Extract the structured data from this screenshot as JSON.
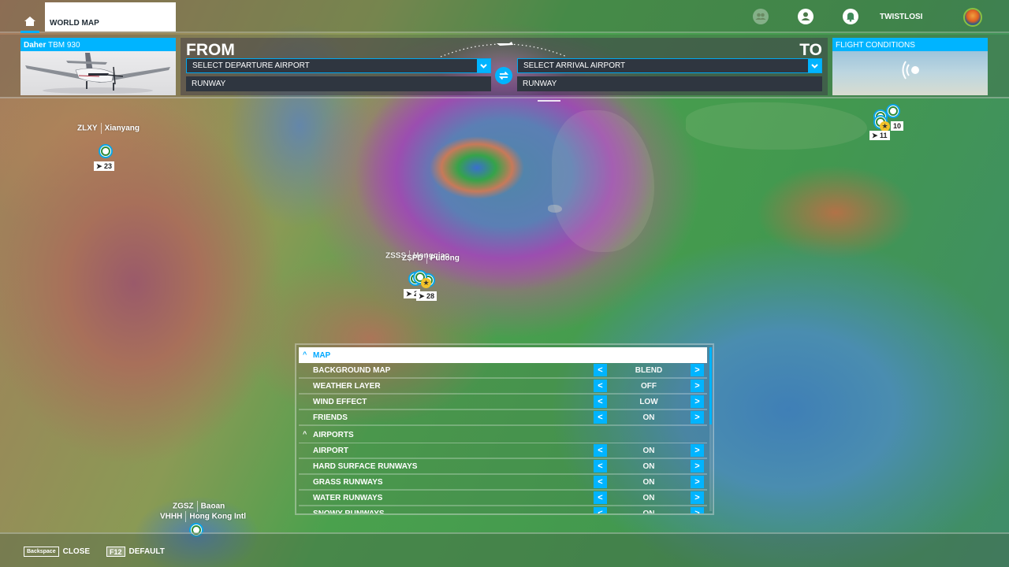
{
  "topbar": {
    "tab_label": "WORLD MAP",
    "username": "TWISTLOSI",
    "icons": [
      "home-icon",
      "friends-icon",
      "profile-icon",
      "notification-bell-icon",
      "avatar"
    ]
  },
  "aircraft": {
    "brand": "Daher",
    "model": "TBM 930"
  },
  "route": {
    "from_label": "FROM",
    "to_label": "TO",
    "departure_placeholder": "SELECT DEPARTURE AIRPORT",
    "arrival_placeholder": "SELECT ARRIVAL AIRPORT",
    "departure_runway": "RUNWAY",
    "arrival_runway": "RUNWAY"
  },
  "conditions": {
    "title": "FLIGHT CONDITIONS",
    "icon": "live-weather-icon"
  },
  "map_markers": [
    {
      "icao": "ZLXY",
      "name": "Xianyang",
      "runways": "23"
    },
    {
      "icao": "ZSSS",
      "name": "Hongqiao",
      "runways": "2"
    },
    {
      "icao": "ZSPD",
      "name": "Pudong",
      "runways": "28"
    },
    {
      "icao": "",
      "name": "",
      "runways": "10",
      "starred": true
    },
    {
      "icao": "",
      "name": "",
      "runways": "11"
    },
    {
      "icao": "ZGSZ",
      "name": "Baoan"
    },
    {
      "icao": "VHHH",
      "name": "Hong Kong Intl"
    }
  ],
  "settings": {
    "sections": [
      {
        "title": "MAP",
        "active": true,
        "rows": [
          {
            "label": "BACKGROUND MAP",
            "value": "BLEND"
          },
          {
            "label": "WEATHER LAYER",
            "value": "OFF"
          },
          {
            "label": "WIND EFFECT",
            "value": "LOW"
          },
          {
            "label": "FRIENDS",
            "value": "ON"
          }
        ]
      },
      {
        "title": "AIRPORTS",
        "active": false,
        "rows": [
          {
            "label": "AIRPORT",
            "value": "ON"
          },
          {
            "label": "HARD SURFACE RUNWAYS",
            "value": "ON"
          },
          {
            "label": "GRASS RUNWAYS",
            "value": "ON"
          },
          {
            "label": "WATER RUNWAYS",
            "value": "ON"
          },
          {
            "label": "SNOWY RUNWAYS",
            "value": "ON"
          }
        ]
      }
    ],
    "prev_glyph": "<",
    "next_glyph": ">",
    "collapse_glyph": "^"
  },
  "bottombar": {
    "close_key": "Backspace",
    "close_label": "CLOSE",
    "default_key": "F12",
    "default_label": "DEFAULT"
  },
  "colors": {
    "accent": "#00b4ff",
    "field_bg": "#2f3640",
    "marker_ring": "#0aa6e6",
    "star_badge": "#f2c22a"
  }
}
